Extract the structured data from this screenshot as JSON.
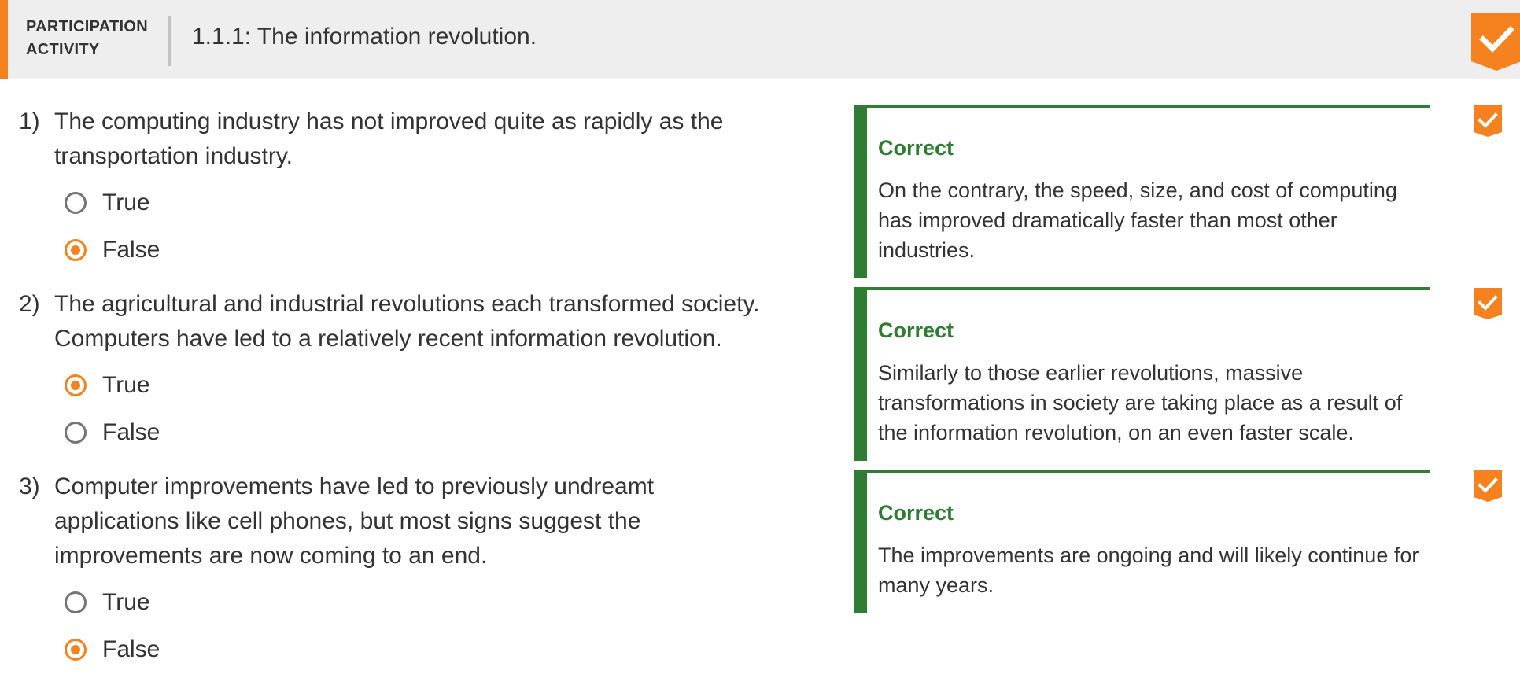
{
  "header": {
    "label_line1": "PARTICIPATION",
    "label_line2": "ACTIVITY",
    "title": "1.1.1: The information revolution.",
    "accent_color": "#f5821f",
    "completion_icon": "check-ribbon-icon"
  },
  "questions": [
    {
      "number": "1)",
      "text": "The computing industry has not improved quite as rapidly as the transportation industry.",
      "options": [
        {
          "label": "True",
          "selected": false
        },
        {
          "label": "False",
          "selected": true
        }
      ],
      "feedback": {
        "status": "Correct",
        "explanation": "On the contrary, the speed, size, and cost of computing has improved dramatically faster than most other industries."
      }
    },
    {
      "number": "2)",
      "text": "The agricultural and industrial revolutions each transformed society. Computers have led to a relatively recent information revolution.",
      "options": [
        {
          "label": "True",
          "selected": true
        },
        {
          "label": "False",
          "selected": false
        }
      ],
      "feedback": {
        "status": "Correct",
        "explanation": "Similarly to those earlier revolutions, massive transformations in society are taking place as a result of the information revolution, on an even faster scale."
      }
    },
    {
      "number": "3)",
      "text": "Computer improvements have led to previously undreamt applications like cell phones, but most signs suggest the improvements are now coming to an end.",
      "options": [
        {
          "label": "True",
          "selected": false
        },
        {
          "label": "False",
          "selected": true
        }
      ],
      "feedback": {
        "status": "Correct",
        "explanation": "The improvements are ongoing and will likely continue for many years."
      }
    }
  ],
  "colors": {
    "accent": "#f5821f",
    "correct": "#2e7d32",
    "header_bg": "#eeeeee",
    "text": "#333333"
  }
}
